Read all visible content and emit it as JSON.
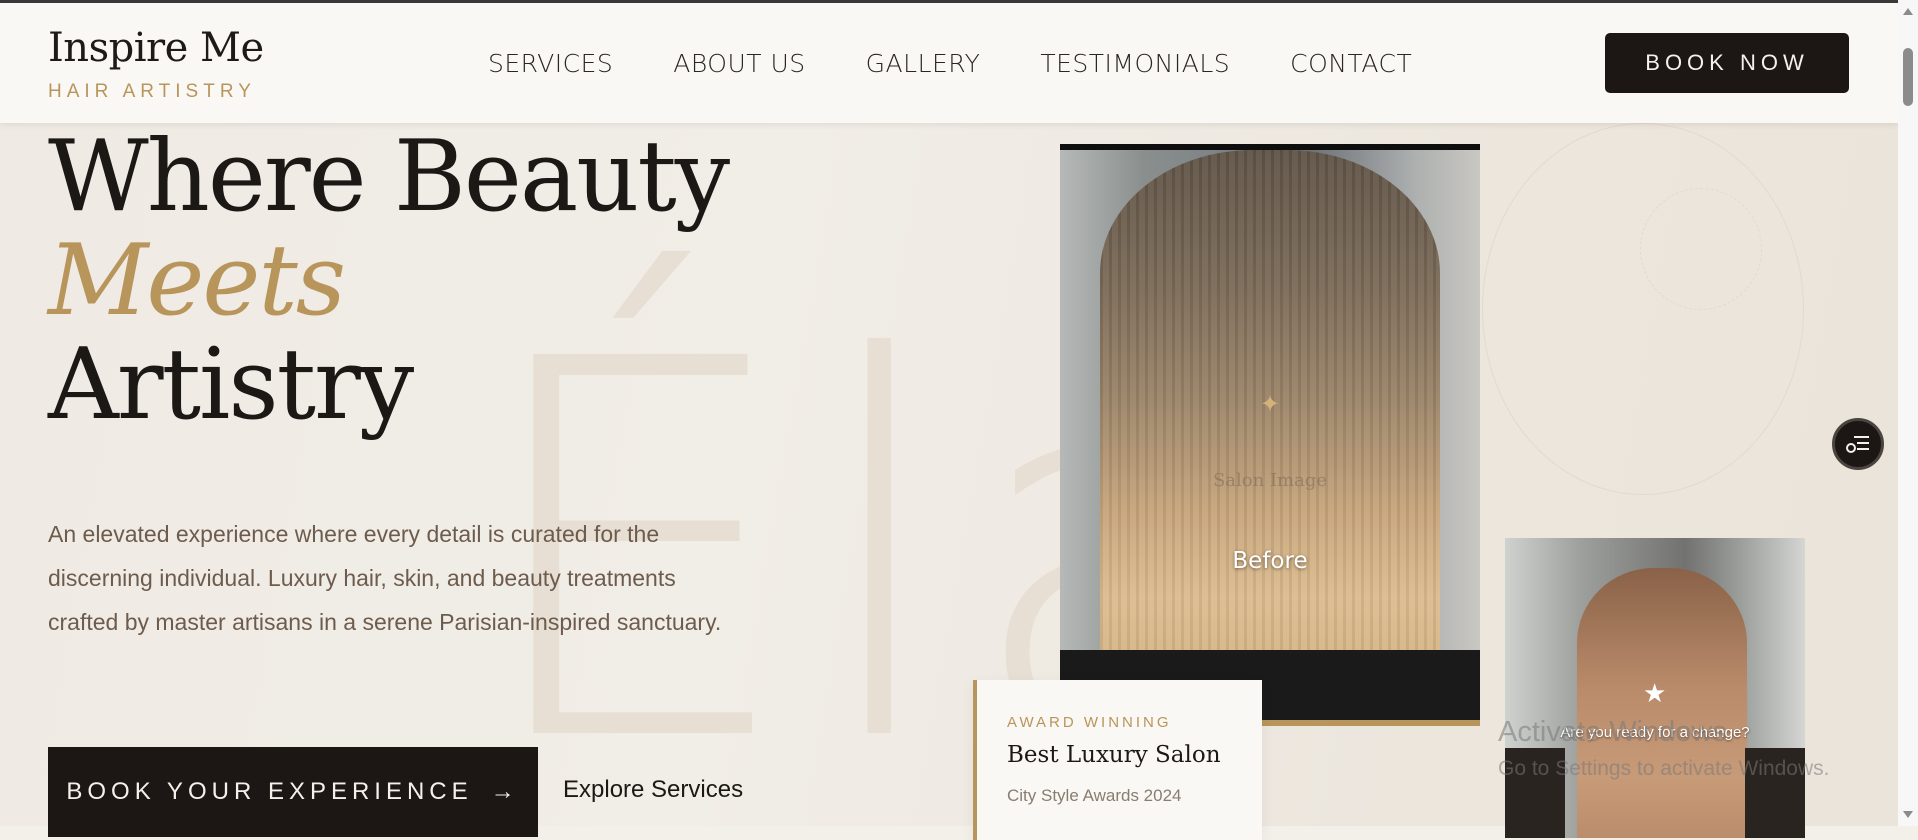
{
  "header": {
    "brand_name": "Inspire Me",
    "brand_tagline": "HAIR ARTISTRY",
    "nav": [
      "SERVICES",
      "ABOUT US",
      "GALLERY",
      "TESTIMONIALS",
      "CONTACT"
    ],
    "book_now_label": "BOOK NOW"
  },
  "hero": {
    "watermark": "Éla",
    "headline_line1": "Where Beauty",
    "headline_line2": "Meets",
    "headline_line3": "Artistry",
    "description": "An elevated experience where every detail is curated for the discerning individual. Luxury hair, skin, and beauty treatments crafted by master artisans in a serene Parisian-inspired sanctuary.",
    "cta_primary": "BOOK YOUR EXPERIENCE",
    "cta_primary_arrow": "→",
    "cta_secondary": "Explore Services"
  },
  "before_image": {
    "overlay_text": "Salon Image",
    "label": "Before"
  },
  "award": {
    "kicker": "AWARD WINNING",
    "title": "Best Luxury Salon",
    "subtitle": "City Style Awards 2024"
  },
  "after_image": {
    "caption": "Are you ready for a change?"
  },
  "os_watermark": {
    "title": "Activate Windows",
    "subtitle": "Go to Settings to activate Windows."
  },
  "colors": {
    "accent_gold": "#b8955a",
    "dark": "#1c1714",
    "background": "#f3efe9"
  },
  "icons": {
    "cta_arrow": "arrow-right-icon",
    "floating": "accessibility-menu-icon",
    "sparkle": "sparkle-icon",
    "star": "star-icon"
  }
}
